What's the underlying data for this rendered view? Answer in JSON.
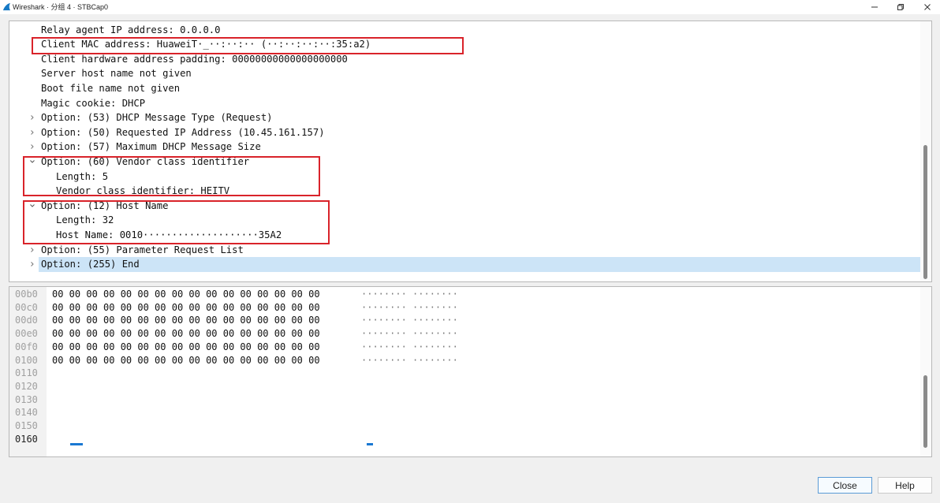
{
  "window": {
    "title": "Wireshark · 分组 4 · STBCap0"
  },
  "tree": {
    "lines": [
      {
        "text": "Relay agent IP address: 0.0.0.0",
        "indent": 0,
        "arrow": "none"
      },
      {
        "text": "Client MAC address: HuaweiT·_··:··:·· (··:··:··:··:35:a2)",
        "indent": 0,
        "arrow": "none"
      },
      {
        "text": "Client hardware address padding: 00000000000000000000",
        "indent": 0,
        "arrow": "none"
      },
      {
        "text": "Server host name not given",
        "indent": 0,
        "arrow": "none"
      },
      {
        "text": "Boot file name not given",
        "indent": 0,
        "arrow": "none"
      },
      {
        "text": "Magic cookie: DHCP",
        "indent": 0,
        "arrow": "none"
      },
      {
        "text": "Option: (53) DHCP Message Type (Request)",
        "indent": 0,
        "arrow": "collapsed"
      },
      {
        "text": "Option: (50) Requested IP Address (10.45.161.157)",
        "indent": 0,
        "arrow": "collapsed"
      },
      {
        "text": "Option: (57) Maximum DHCP Message Size",
        "indent": 0,
        "arrow": "collapsed"
      },
      {
        "text": "Option: (60) Vendor class identifier",
        "indent": 0,
        "arrow": "expanded"
      },
      {
        "text": "Length: 5",
        "indent": 1,
        "arrow": "none"
      },
      {
        "text": "Vendor class identifier: HEITV",
        "indent": 1,
        "arrow": "none"
      },
      {
        "text": "Option: (12) Host Name",
        "indent": 0,
        "arrow": "expanded"
      },
      {
        "text": "Length: 32",
        "indent": 1,
        "arrow": "none"
      },
      {
        "text": "Host Name: 0010····················35A2",
        "indent": 1,
        "arrow": "none"
      },
      {
        "text": "Option: (55) Parameter Request List",
        "indent": 0,
        "arrow": "collapsed"
      },
      {
        "text": "Option: (255) End",
        "indent": 0,
        "arrow": "collapsed",
        "selected": true
      }
    ]
  },
  "bytes": {
    "rows": [
      {
        "offset": "00b0",
        "hex": "00 00 00 00 00 00 00 00  00 00 00 00 00 00 00 00",
        "ascii": "········ ········"
      },
      {
        "offset": "00c0",
        "hex": "00 00 00 00 00 00 00 00  00 00 00 00 00 00 00 00",
        "ascii": "········ ········"
      },
      {
        "offset": "00d0",
        "hex": "00 00 00 00 00 00 00 00  00 00 00 00 00 00 00 00",
        "ascii": "········ ········"
      },
      {
        "offset": "00e0",
        "hex": "00 00 00 00 00 00 00 00  00 00 00 00 00 00 00 00",
        "ascii": "········ ········"
      },
      {
        "offset": "00f0",
        "hex": "00 00 00 00 00 00 00 00  00 00 00 00 00 00 00 00",
        "ascii": "········ ········"
      },
      {
        "offset": "0100",
        "hex": "00 00 00 00 00 00 00 00  00 00 00 00 00 00 00 00",
        "ascii": "········ ········"
      },
      {
        "offset": "0110",
        "hex": "",
        "ascii": ""
      },
      {
        "offset": "0120",
        "hex": "",
        "ascii": ""
      },
      {
        "offset": "0130",
        "hex": "",
        "ascii": ""
      },
      {
        "offset": "0140",
        "hex": "",
        "ascii": ""
      },
      {
        "offset": "0150",
        "hex": "",
        "ascii": ""
      },
      {
        "offset": "0160",
        "hex": "",
        "ascii": "",
        "active": true
      }
    ]
  },
  "buttons": {
    "close": "Close",
    "help": "Help"
  },
  "colors": {
    "highlight_box": "#d9232a",
    "selected_row": "#cce4f7",
    "byte_marker": "#1a78d2"
  }
}
